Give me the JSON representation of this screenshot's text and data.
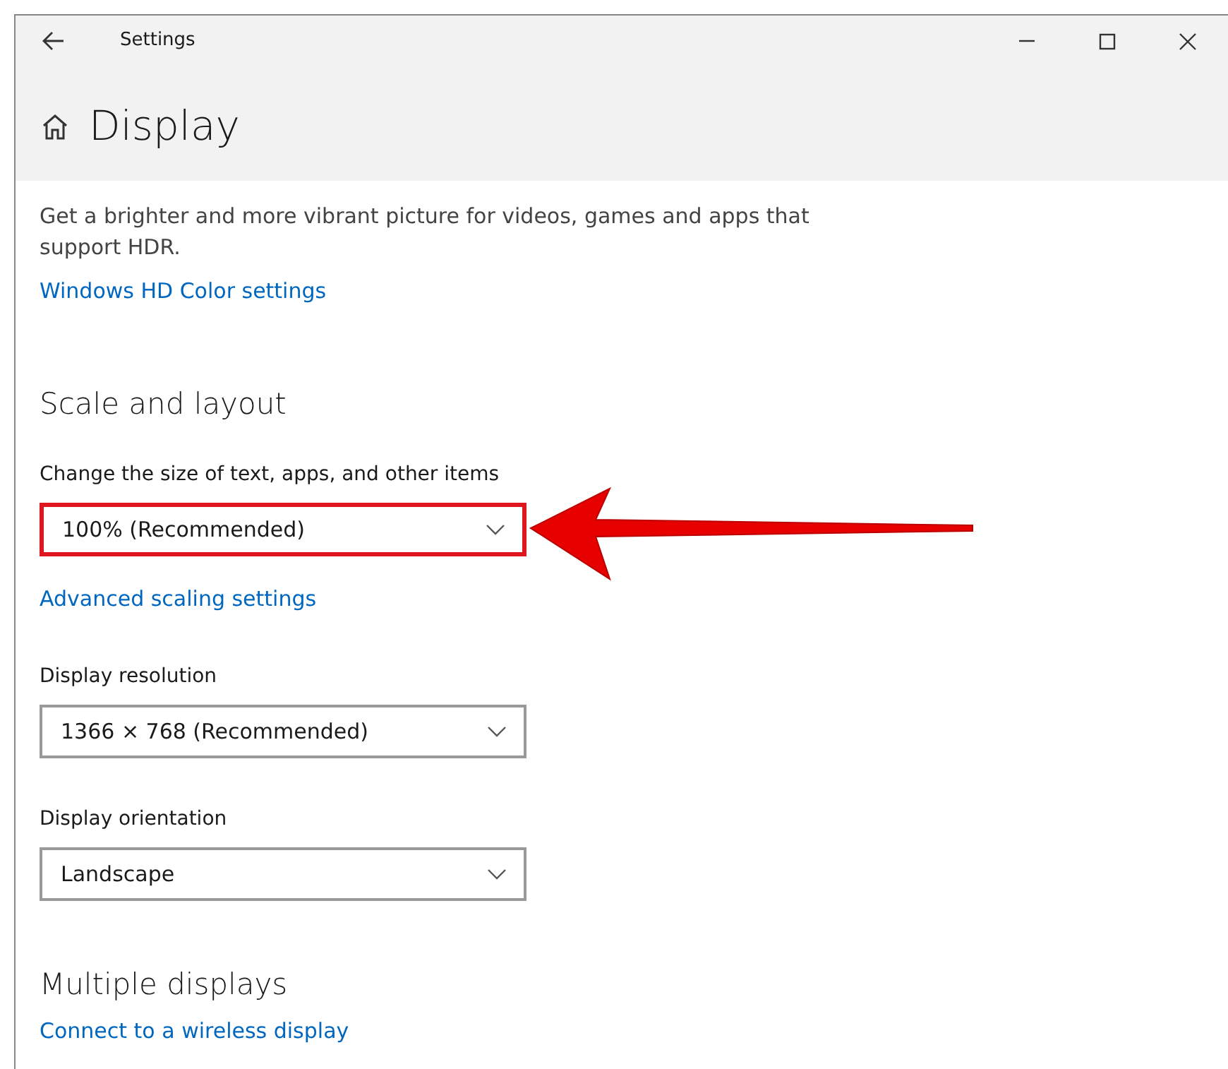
{
  "window": {
    "title": "Settings"
  },
  "page_title": "Display",
  "hdr_description": "Get a brighter and more vibrant picture for videos, games and apps that support HDR.",
  "sections": [
    {
      "kind": "link",
      "text": "Windows HD Color settings"
    },
    {
      "kind": "heading",
      "text": "Scale and layout"
    },
    {
      "kind": "label",
      "text": "Change the size of text, apps, and other items"
    },
    {
      "kind": "dropdown",
      "value": "100% (Recommended)",
      "highlighted": true
    },
    {
      "kind": "link",
      "text": "Advanced scaling settings"
    },
    {
      "kind": "label",
      "text": "Display resolution"
    },
    {
      "kind": "dropdown",
      "value": "1366 × 768 (Recommended)",
      "highlighted": false
    },
    {
      "kind": "label",
      "text": "Display orientation"
    },
    {
      "kind": "dropdown",
      "value": "Landscape",
      "highlighted": false
    },
    {
      "kind": "heading",
      "text": "Multiple displays"
    },
    {
      "kind": "link",
      "text": "Connect to a wireless display"
    }
  ]
}
